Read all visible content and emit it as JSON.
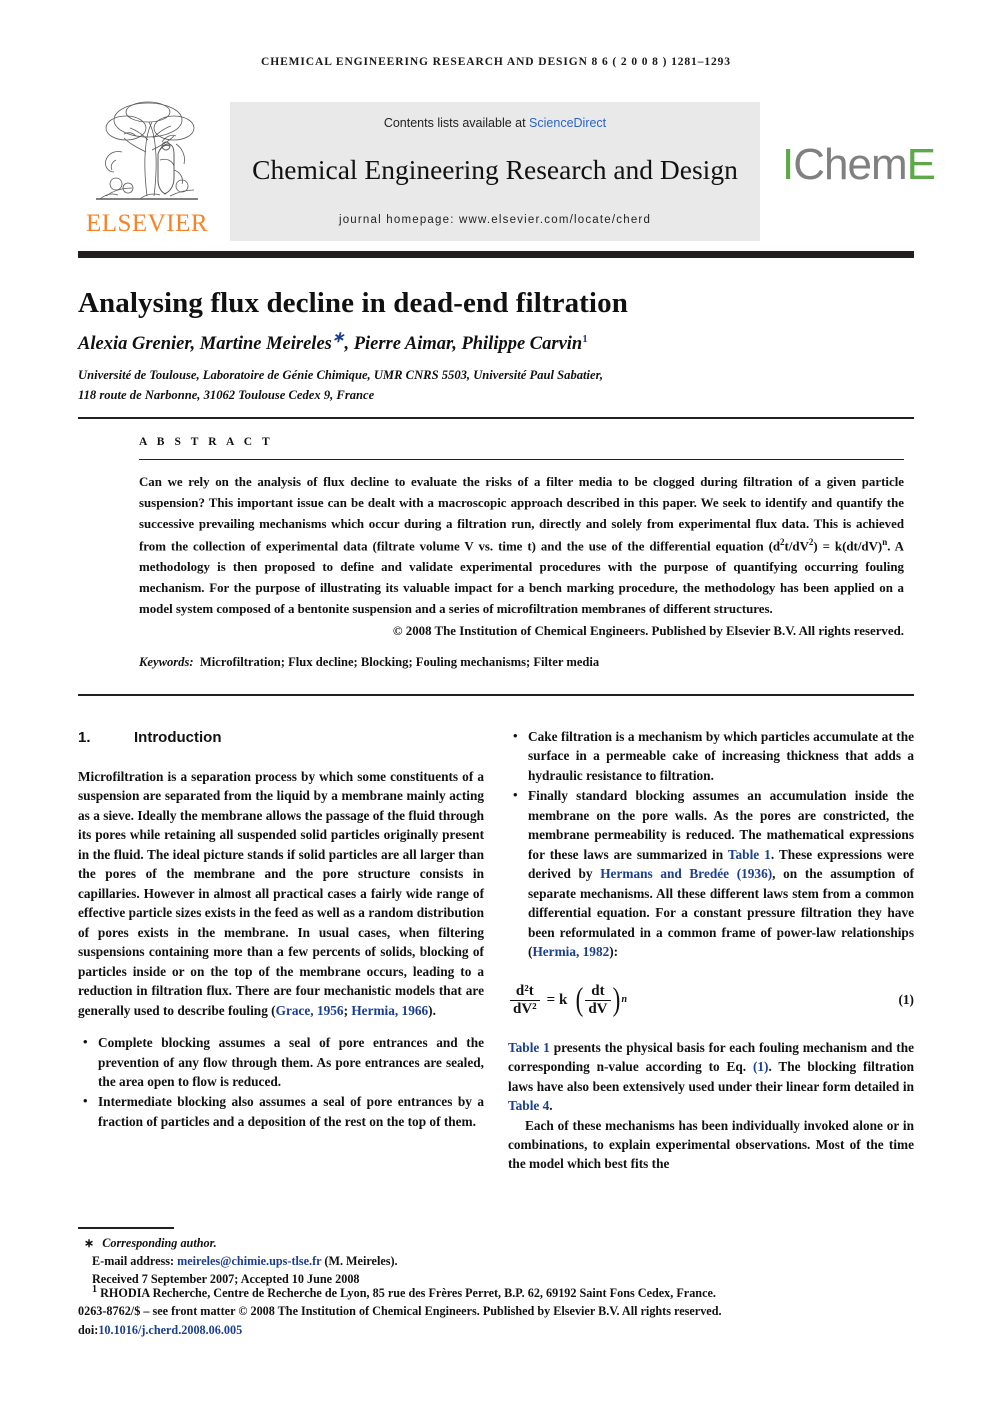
{
  "running_head": "CHEMICAL ENGINEERING RESEARCH AND DESIGN  8 6  ( 2 0 0 8 ) 1281–1293",
  "masthead": {
    "publisher_logo_text": "ELSEVIER",
    "contents_prefix": "Contents lists available at ",
    "contents_link": "ScienceDirect",
    "journal_title": "Chemical Engineering Research and Design",
    "homepage": "journal homepage: www.elsevier.com/locate/cherd",
    "society_logo": {
      "part1": "I",
      "part2": "Chem",
      "part3": "E"
    },
    "colors": {
      "elsevier_orange": "#F6832A",
      "icheme_green": "#5CA84B",
      "icheme_grey": "#808080",
      "link_blue": "#2a63c8",
      "banner_grey": "#e9e9e9"
    }
  },
  "article": {
    "title": "Analysing flux decline in dead-end filtration",
    "authors": "Alexia Grenier, Martine Meireles",
    "authors_corresponding_mark": "∗",
    "authors_rest": ", Pierre Aimar, Philippe Carvin",
    "authors_footnote_mark": "1",
    "affiliation_line1": "Université de Toulouse, Laboratoire de Génie Chimique, UMR CNRS 5503, Université Paul Sabatier,",
    "affiliation_line2": "118 route de Narbonne, 31062 Toulouse Cedex 9, France"
  },
  "abstract": {
    "label": "A B S T R A C T",
    "text_part1": "Can we rely on the analysis of flux decline to evaluate the risks of a filter media to be clogged during filtration of a given particle suspension? This important issue can be dealt with a macroscopic approach described in this paper. We seek to identify and quantify the successive prevailing mechanisms which occur during a filtration run, directly and solely from experimental flux data. This is achieved from the collection of experimental data (filtrate volume V vs. time t) and the use of the differential equation (d",
    "eq_sup1": "2",
    "text_part2": "t/dV",
    "eq_sup2": "2",
    "text_part3": ") = k(dt/dV)",
    "eq_sup3": "n",
    "text_part4": ". A methodology is then proposed to define and validate experimental procedures with the purpose of quantifying occurring fouling mechanism. For the purpose of illustrating its valuable impact for a bench marking procedure, the methodology has been applied on a model system composed of a bentonite suspension and a series of microfiltration membranes of different structures.",
    "copyright": "© 2008 The Institution of Chemical Engineers. Published by Elsevier B.V. All rights reserved.",
    "keywords_label": "Keywords:",
    "keywords_value": "Microfiltration; Flux decline; Blocking; Fouling mechanisms; Filter media"
  },
  "body": {
    "section_number": "1.",
    "section_title": "Introduction",
    "para1": "Microfiltration is a separation process by which some constituents of a suspension are separated from the liquid by a membrane mainly acting as a sieve. Ideally the membrane allows the passage of the fluid through its pores while retaining all suspended solid particles originally present in the fluid. The ideal picture stands if solid particles are all larger than the pores of the membrane and the pore structure consists in capillaries. However in almost all practical cases a fairly wide range of effective particle sizes exists in the feed as well as a random distribution of pores exists in the membrane. In usual cases, when filtering suspensions containing more than a few percents of solids, blocking of particles inside or on the top of the membrane occurs, leading to a reduction in filtration flux. There are four mechanistic models that are generally used to describe fouling (",
    "para1_ref1": "Grace, 1956",
    "para1_sep": "; ",
    "para1_ref2": "Hermia, 1966",
    "para1_end": ").",
    "bullet1": "Complete blocking assumes a seal of pore entrances and the prevention of any flow through them. As pore entrances are sealed, the area open to flow is reduced.",
    "bullet2": "Intermediate blocking also assumes a seal of pore entrances by a fraction of particles and a deposition of the rest on the top of them.",
    "bullet3": "Cake filtration is a mechanism by which particles accumulate at the surface in a permeable cake of increasing thickness that adds a hydraulic resistance to filtration.",
    "bullet4_a": "Finally standard blocking assumes an accumulation inside the membrane on the pore walls. As the pores are constricted, the membrane permeability is reduced. The mathematical expressions for these laws are summarized in ",
    "bullet4_ref1": "Table 1",
    "bullet4_b": ". These expressions were derived by ",
    "bullet4_ref2": "Hermans and Bredée (1936)",
    "bullet4_c": ", on the assumption of separate mechanisms. All these different laws stem from a common differential equation. For a constant pressure filtration they have been reformulated in a common frame of power-law relationships (",
    "bullet4_ref3": "Hermia, 1982",
    "bullet4_d": "):",
    "equation": {
      "lhs_num": "d²t",
      "lhs_den": "dV²",
      "op": "= k",
      "rhs_num": "dt",
      "rhs_den": "dV",
      "exp": "n",
      "number": "(1)"
    },
    "para2_ref1": "Table 1",
    "para2_a": " presents the physical basis for each fouling mechanism and the corresponding n-value according to Eq. ",
    "para2_ref2": "(1)",
    "para2_b": ". The blocking filtration laws have also been extensively used under their linear form detailed in ",
    "para2_ref3": "Table 4",
    "para2_c": ".",
    "para3": "Each of these mechanisms has been individually invoked alone or in combinations, to explain experimental observations. Most of the time the model which best fits the"
  },
  "footer": {
    "corresponding_mark": "∗",
    "corresponding_label": "Corresponding author.",
    "email_label": "E-mail address: ",
    "email": "meireles@chimie.ups-tlse.fr",
    "email_suffix": " (M. Meireles).",
    "dates": "Received 7 September 2007; Accepted 10 June 2008",
    "fn1_mark": "1",
    "fn1_text": "RHODIA Recherche, Centre de Recherche de Lyon, 85 rue des Frères Perret, B.P. 62, 69192 Saint Fons Cedex, France.",
    "issn_line": "0263-8762/$ – see front matter © 2008 The Institution of Chemical Engineers. Published by Elsevier B.V. All rights reserved.",
    "doi_label": "doi:",
    "doi_value": "10.1016/j.cherd.2008.06.005"
  }
}
